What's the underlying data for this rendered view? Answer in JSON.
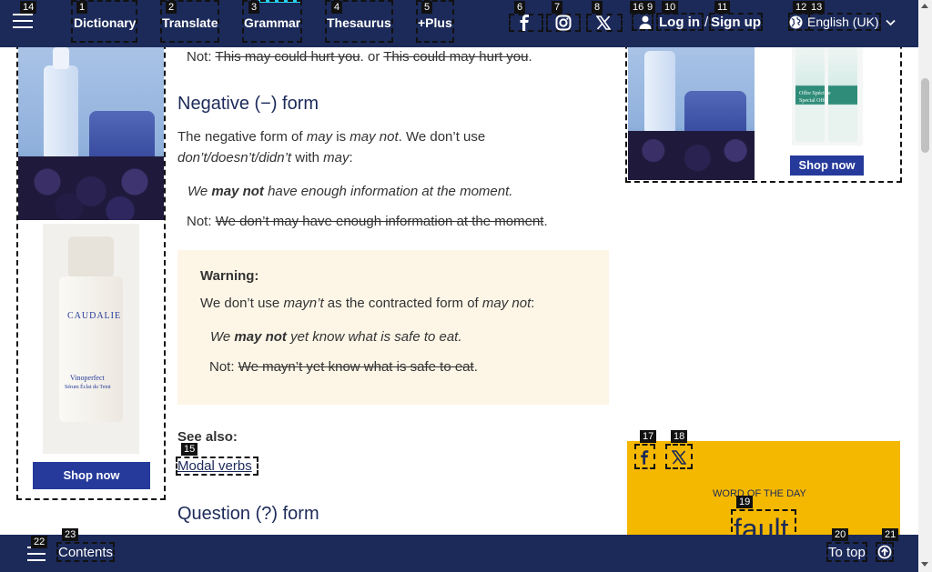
{
  "nav": {
    "items": [
      {
        "num": "1",
        "label": "Dictionary"
      },
      {
        "num": "2",
        "label": "Translate"
      },
      {
        "num": "3",
        "label": "Grammar"
      },
      {
        "num": "4",
        "label": "Thesaurus"
      },
      {
        "num": "5",
        "label": "+Plus"
      }
    ],
    "menu_num": "14",
    "social_nums": [
      "6",
      "7",
      "8"
    ],
    "login_num": "10",
    "login_label": "Log in",
    "login_sep": "/",
    "signup_num": "11",
    "signup_label": "Sign up",
    "lang_nums": [
      "12",
      "13"
    ],
    "lang_label": "English (UK)",
    "extra_num": "16",
    "extra_num_b": "9"
  },
  "ads": {
    "left_shop": "Shop now",
    "right_shop": "Shop now",
    "brand": "CAUDALIE",
    "product_name": "Vinoperfect",
    "product_sub": "Sérum Éclat du Teint",
    "offer_line1": "Offre Spéciale",
    "offer_line2": "Special Offer"
  },
  "article": {
    "not1_prefix": "Not: ",
    "not1_a": "This may could hurt you",
    "not1_mid": ". or ",
    "not1_b": "This could may hurt you",
    "not1_end": ".",
    "neg_heading": "Negative (−) form",
    "neg_p1_a": "The negative form of ",
    "neg_p1_b": "may",
    "neg_p1_c": " is ",
    "neg_p1_d": "may not",
    "neg_p1_e": ". We don’t use",
    "neg_p2_a": "don’t/doesn’t/didn’t",
    "neg_p2_b": " with ",
    "neg_p2_c": "may",
    "neg_p2_d": ":",
    "ex1_a": "We ",
    "ex1_b": "may not",
    "ex1_c": " have enough information at the moment.",
    "not2_prefix": "Not: ",
    "not2_text": "We don’t may have enough information at the moment",
    "not2_end": ".",
    "warning_title": "Warning:",
    "warn_a": "We don’t use ",
    "warn_b": "mayn’t",
    "warn_c": " as the contracted form of ",
    "warn_d": "may not",
    "warn_e": ":",
    "ex2_a": "We ",
    "ex2_b": "may not",
    "ex2_c": " yet know what is safe to eat.",
    "not3_prefix": "Not: ",
    "not3_text": "We mayn’t yet know what is safe to eat",
    "not3_end": ".",
    "see_also": "See also:",
    "modal_num": "15",
    "modal_link": "Modal verbs",
    "q_heading": "Question (?) form"
  },
  "wotd": {
    "fb_num": "17",
    "x_num": "18",
    "title": "WORD OF THE DAY",
    "word_num": "19",
    "word": "fault"
  },
  "bottom": {
    "menu_num": "22",
    "contents_num": "23",
    "contents": "Contents",
    "totop_num": "20",
    "totop": "To top",
    "up_num": "21"
  }
}
